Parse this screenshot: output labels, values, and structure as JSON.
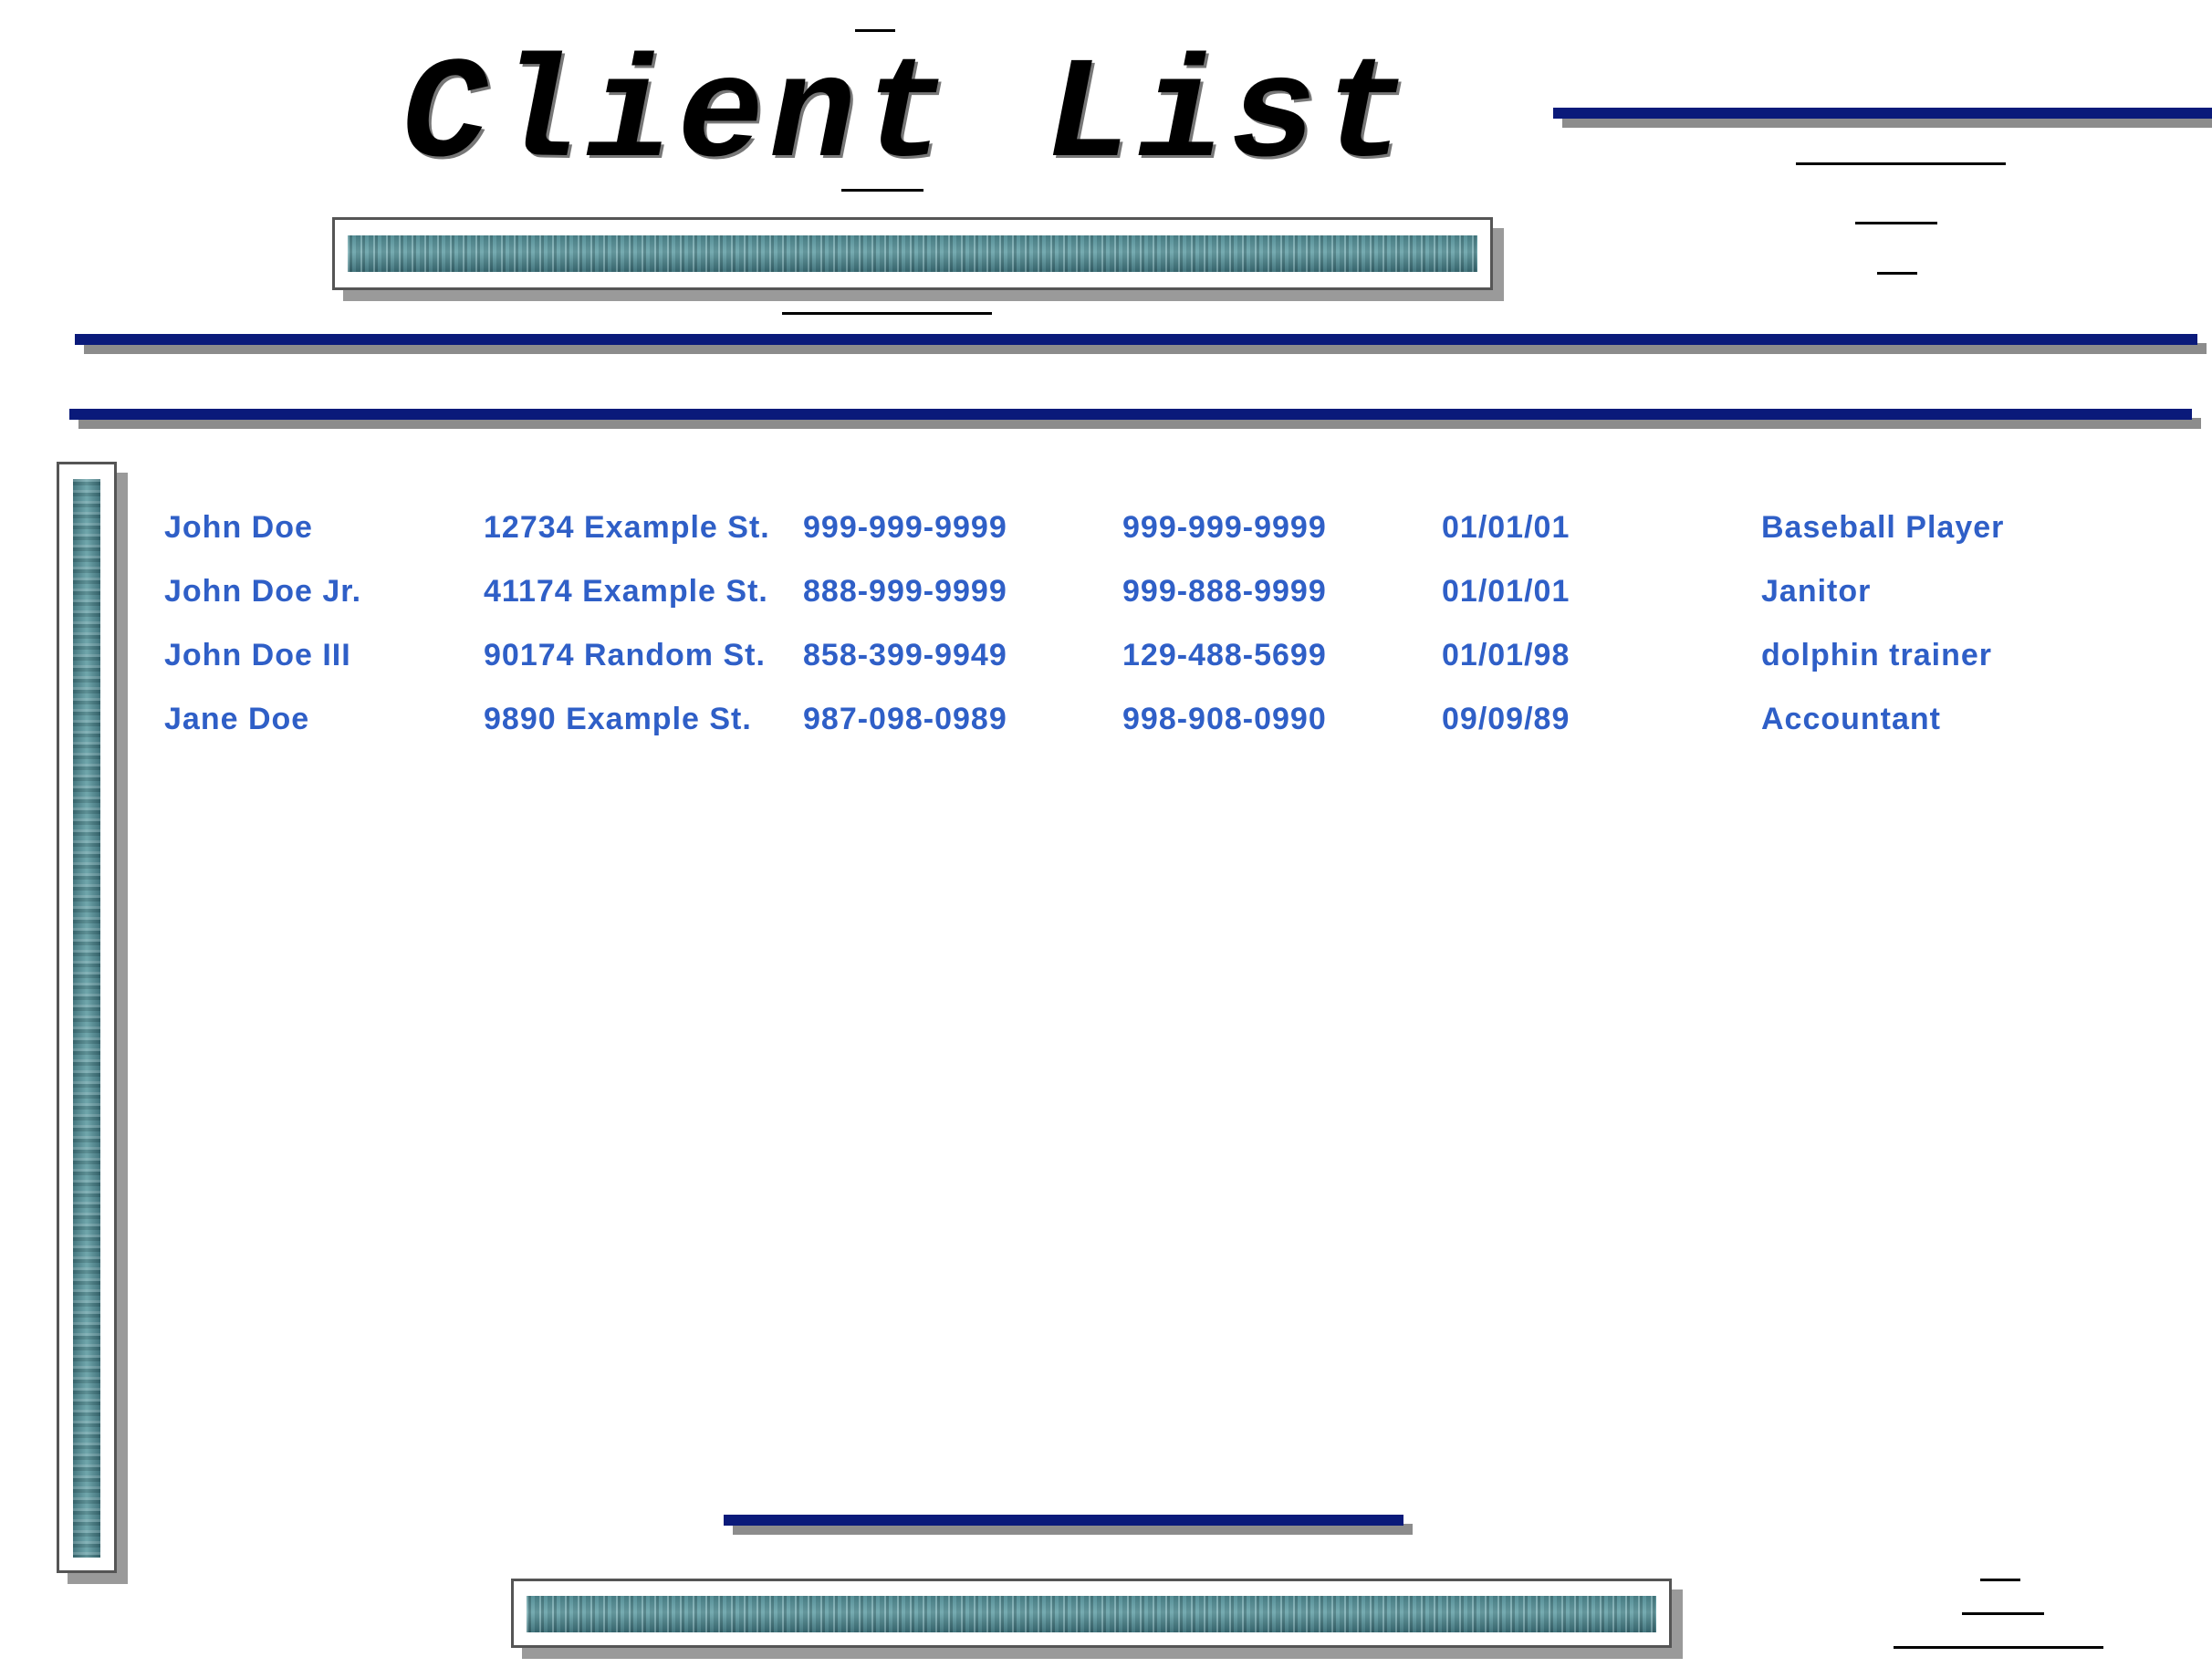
{
  "title": "Client List",
  "clients": [
    {
      "name": "John Doe",
      "address": "12734 Example St.",
      "phone1": "999-999-9999",
      "phone2": "999-999-9999",
      "date": "01/01/01",
      "occupation": "Baseball Player"
    },
    {
      "name": "John Doe Jr.",
      "address": "41174 Example St.",
      "phone1": "888-999-9999",
      "phone2": "999-888-9999",
      "date": "01/01/01",
      "occupation": "Janitor"
    },
    {
      "name": "John Doe III",
      "address": "90174 Random St.",
      "phone1": "858-399-9949",
      "phone2": "129-488-5699",
      "date": "01/01/98",
      "occupation": "dolphin trainer"
    },
    {
      "name": "Jane Doe",
      "address": "9890 Example St.",
      "phone1": "987-098-0989",
      "phone2": "998-908-0990",
      "date": "09/09/89",
      "occupation": "Accountant"
    }
  ],
  "colors": {
    "text": "#2f5fc7",
    "bar": "#0a1a7a",
    "shadow": "#8c8c8c"
  }
}
